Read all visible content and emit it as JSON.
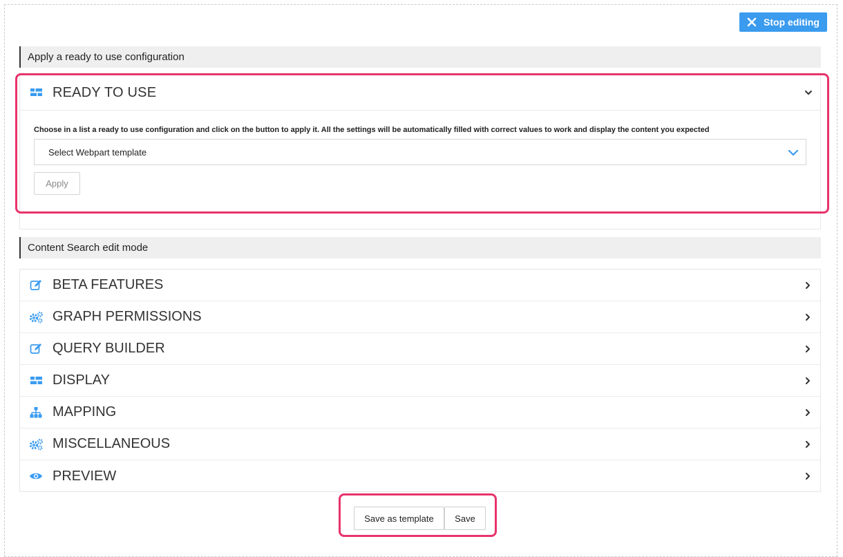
{
  "toolbar": {
    "stop_editing_label": "Stop editing"
  },
  "sections": {
    "ready_header": "Apply a ready to use configuration",
    "edit_header": "Content Search edit mode"
  },
  "ready_panel": {
    "title": "READY TO USE",
    "icon": "grid-icon",
    "description": "Choose in a list a ready to use configuration and click on the button to apply it. All the settings will be automatically filled with correct values to work and display the content you expected",
    "select_value": "Select Webpart template",
    "apply_label": "Apply"
  },
  "accordion": [
    {
      "label": "BETA FEATURES",
      "icon": "edit-icon"
    },
    {
      "label": "GRAPH PERMISSIONS",
      "icon": "cogs-icon"
    },
    {
      "label": "QUERY BUILDER",
      "icon": "edit-icon"
    },
    {
      "label": "DISPLAY",
      "icon": "grid-icon"
    },
    {
      "label": "MAPPING",
      "icon": "sitemap-icon"
    },
    {
      "label": "MISCELLANEOUS",
      "icon": "cogs-icon"
    },
    {
      "label": "PREVIEW",
      "icon": "eye-icon"
    }
  ],
  "footer": {
    "save_as_template_label": "Save as template",
    "save_label": "Save"
  },
  "colors": {
    "accent": "#3a9bef",
    "highlight": "#e8336b"
  }
}
